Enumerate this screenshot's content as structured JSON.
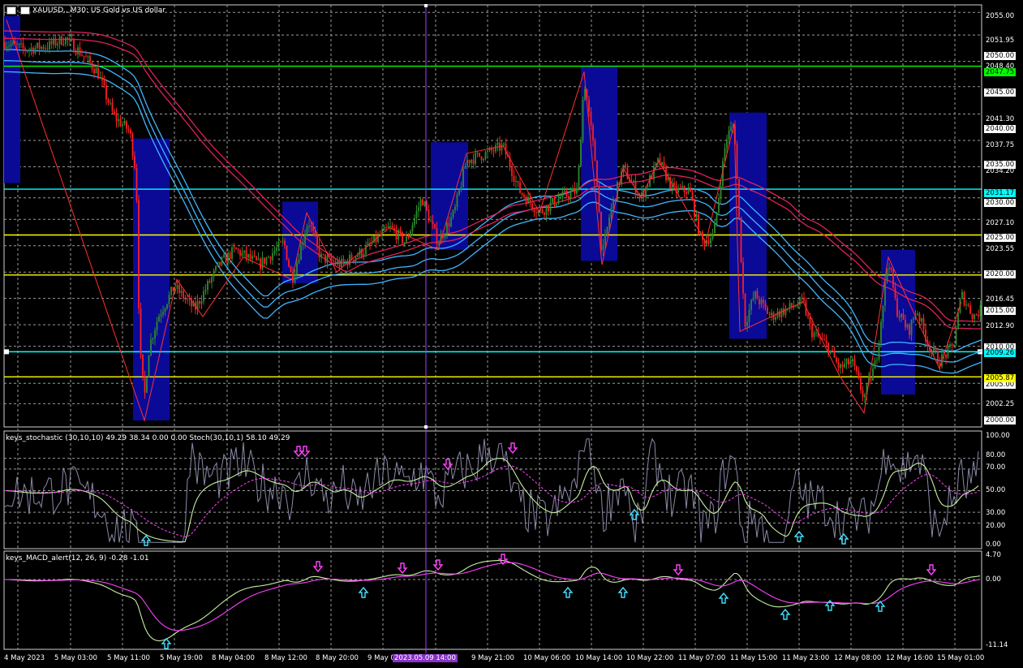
{
  "window": {
    "title": "XAUUSD., M30:  US Gold vs US dollar"
  },
  "stochastic": {
    "header": "keys_stochastic (30,10,10) 49.29 38.34 0.00 0.00 Stoch(30,10,1) 58.10 49.29",
    "scale": [
      "100.00",
      "80.00",
      "70.00",
      "50.00",
      "30.00",
      "20.00",
      "0.00"
    ]
  },
  "macd": {
    "header": "keys_MACD_alert(12, 26, 9) -0.28 -1.01",
    "scale": [
      "4.70",
      "0.00",
      "-11.14"
    ]
  },
  "price_scale": [
    "2055.00",
    "2051.95",
    "2050.00",
    "2048.40",
    "2045.00",
    "2041.30",
    "2040.00",
    "2037.75",
    "2035.00",
    "2034.20",
    "2030.00",
    "2027.10",
    "2025.00",
    "2023.55",
    "2020.00",
    "2016.45",
    "2015.00",
    "2012.90",
    "2010.00",
    "2005.00",
    "2002.25",
    "2000.00"
  ],
  "price_badges": [
    {
      "text": "2047.75",
      "color": "#00ff00"
    },
    {
      "text": "2031.17",
      "color": "#00ffff"
    },
    {
      "text": "2009.26",
      "color": "#00ffff"
    },
    {
      "text": "2005.87",
      "color": "#ffff00"
    }
  ],
  "time_axis": [
    "4 May 2023",
    "5 May 03:00",
    "5 May 11:00",
    "5 May 19:00",
    "8 May 04:00",
    "8 May 12:00",
    "8 May 20:00",
    "9 May 0",
    "2023.05.09 14:00",
    "9 May 21:00",
    "10 May 06:00",
    "10 May 14:00",
    "10 May 22:00",
    "11 May 07:00",
    "11 May 15:00",
    "11 May 23:00",
    "12 May 08:00",
    "12 May 16:00",
    "15 May 01:00"
  ],
  "colors": {
    "background": "#000000",
    "bull": "#2e8b2e",
    "bear": "#ff2020",
    "box": "#0a0a96",
    "ma_blue": "#3fb6ff",
    "ma_red": "#e0205a",
    "green_line": "#00ff00",
    "cyan_line": "#00ffff",
    "yellow_line": "#ffff00",
    "crosshair": "#a040ff"
  }
}
